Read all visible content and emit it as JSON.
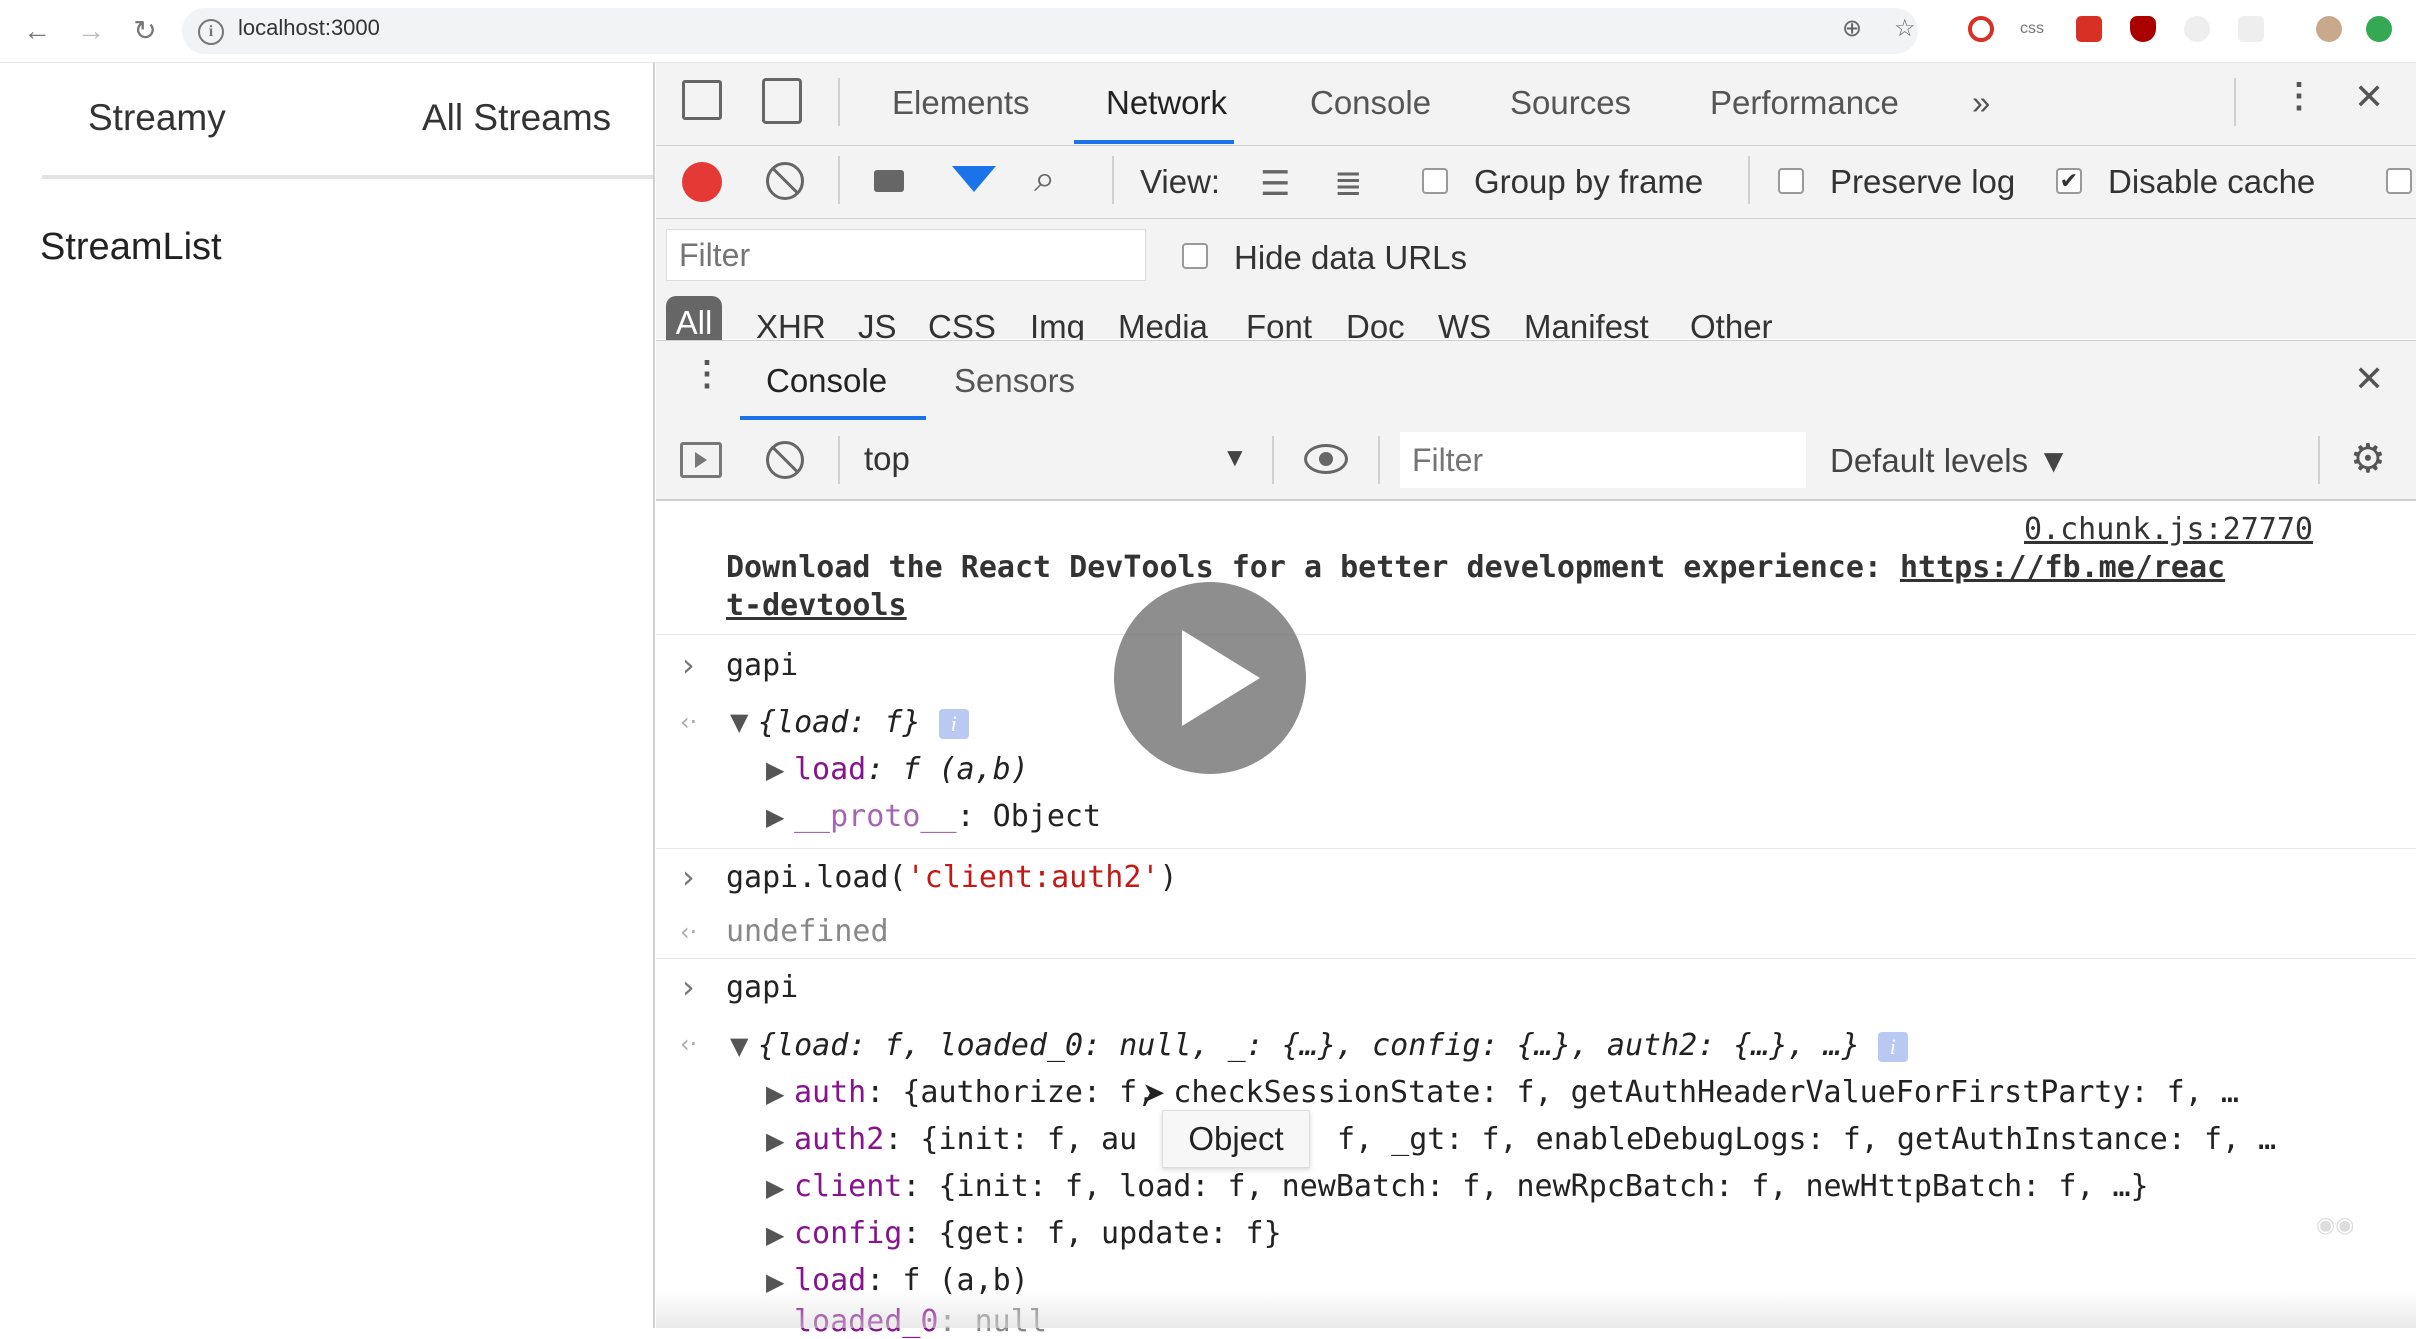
{
  "browser": {
    "url": "localhost:3000",
    "colors": {
      "record": "#e53935",
      "filter_active": "#1a73e8",
      "ext_red": "#d93025",
      "ext_green": "#34a853"
    }
  },
  "app": {
    "nav_left": "Streamy",
    "nav_right": "All Streams",
    "heading": "StreamList"
  },
  "devtools": {
    "tabs": [
      "Elements",
      "Network",
      "Console",
      "Sources",
      "Performance"
    ],
    "more_tabs_icon": "»",
    "network_toolbar": {
      "view_label": "View:",
      "group_by_frame": "Group by frame",
      "preserve_log": "Preserve log",
      "disable_cache": "Disable cache",
      "disable_cache_checked": true,
      "filter_placeholder": "Filter",
      "hide_data_urls": "Hide data URLs"
    },
    "filter_types": [
      "All",
      "XHR",
      "JS",
      "CSS",
      "Img",
      "Media",
      "Font",
      "Doc",
      "WS",
      "Manifest",
      "Other"
    ],
    "drawer_tabs": [
      "Console",
      "Sensors"
    ],
    "console_toolbar": {
      "context": "top",
      "filter_placeholder": "Filter",
      "levels": "Default levels ▼"
    },
    "console": {
      "source_link": "0.chunk.js:27770",
      "react_msg": "Download the React DevTools for a better development experience: ",
      "react_link_1": "https://fb.me/reac",
      "react_link_2": "t-devtools",
      "cmd1": "gapi",
      "obj1": "{load: f}",
      "obj1_load_key": "load",
      "obj1_load_val": ": f (a,b)",
      "obj1_proto_key": "__proto__",
      "obj1_proto_val": ": Object",
      "cmd2_pre": "gapi.load(",
      "cmd2_str": "'client:auth2'",
      "cmd2_post": ")",
      "ret2": "undefined",
      "cmd3": "gapi",
      "obj3": "{load: f, loaded_0: null, _: {…}, config: {…}, auth2: {…}, …}",
      "rows": [
        {
          "key": "auth",
          "val": ": {authorize: f, checkSessionState: f, getAuthHeaderValueForFirstParty: f, …"
        },
        {
          "key": "auth2",
          "val": ": {init: f, au"
        },
        {
          "key": "client",
          "val": ": {init: f, load: f, newBatch: f, newRpcBatch: f, newHttpBatch: f, …}"
        },
        {
          "key": "config",
          "val": ": {get: f, update: f}"
        },
        {
          "key": "load",
          "val": ": f (a,b)"
        },
        {
          "key": "loaded_0",
          "val": ": null"
        }
      ],
      "auth2_tail": "f, _gt: f, enableDebugLogs: f, getAuthInstance: f, …",
      "tooltip": "Object",
      "info_badge": "i"
    }
  }
}
